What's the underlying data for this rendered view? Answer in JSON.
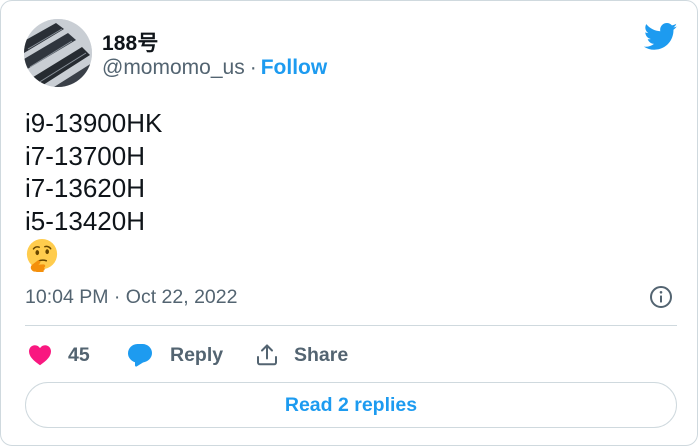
{
  "author": {
    "name": "188号",
    "handle": "@momomo_us",
    "separator": "·",
    "follow_label": "Follow"
  },
  "tweet": {
    "lines": [
      "i9-13900HK",
      "i7-13700H",
      "i7-13620H",
      "i5-13420H"
    ],
    "emoji_icon": "thinking-face-icon",
    "timestamp": "10:04 PM · Oct 22, 2022"
  },
  "actions": {
    "like_count": "45",
    "reply_label": "Reply",
    "share_label": "Share"
  },
  "read_replies_label": "Read 2 replies",
  "colors": {
    "accent": "#1d9bf0",
    "like": "#f91880",
    "muted": "#536471",
    "border": "#cfd9de"
  }
}
